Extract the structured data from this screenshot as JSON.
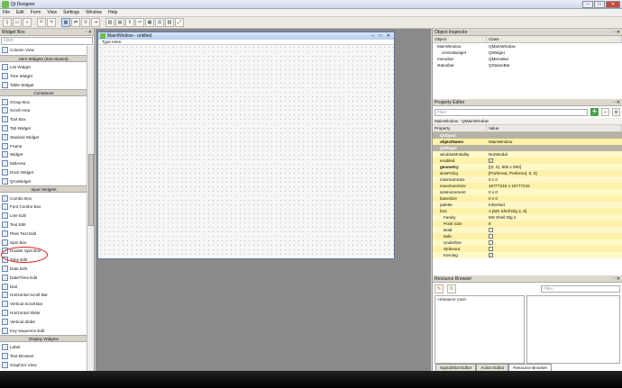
{
  "app": {
    "title": "Qt Designer"
  },
  "window_buttons": {
    "minimize": "–",
    "maximize": "□",
    "close": "✕"
  },
  "menu": [
    "File",
    "Edit",
    "Form",
    "View",
    "Settings",
    "Window",
    "Help"
  ],
  "toolbar_icons": [
    "new-icon",
    "open-icon",
    "save-icon",
    "sep",
    "undo-icon",
    "redo-icon",
    "sep",
    "edit-widgets-icon",
    "edit-signals-icon",
    "edit-buddies-icon",
    "edit-tab-order-icon",
    "sep",
    "layout-horizontal-icon",
    "layout-vertical-icon",
    "layout-split-horizontal-icon",
    "layout-split-vertical-icon",
    "layout-grid-icon",
    "layout-form-icon",
    "break-layout-icon",
    "adjust-size-icon"
  ],
  "widget_box": {
    "title": "Widget Box",
    "filter_placeholder": "Filter",
    "items": [
      {
        "type": "item",
        "label": "Column View"
      },
      {
        "type": "cat",
        "label": "Item Widgets (Item-Based)"
      },
      {
        "type": "item",
        "label": "List Widget"
      },
      {
        "type": "item",
        "label": "Tree Widget"
      },
      {
        "type": "item",
        "label": "Table Widget"
      },
      {
        "type": "cat",
        "label": "Containers"
      },
      {
        "type": "item",
        "label": "Group Box"
      },
      {
        "type": "item",
        "label": "Scroll Area"
      },
      {
        "type": "item",
        "label": "Tool Box"
      },
      {
        "type": "item",
        "label": "Tab Widget"
      },
      {
        "type": "item",
        "label": "Stacked Widget"
      },
      {
        "type": "item",
        "label": "Frame"
      },
      {
        "type": "item",
        "label": "Widget"
      },
      {
        "type": "item",
        "label": "MdiArea"
      },
      {
        "type": "item",
        "label": "Dock Widget"
      },
      {
        "type": "item",
        "label": "QAxWidget"
      },
      {
        "type": "cat",
        "label": "Input Widgets"
      },
      {
        "type": "item",
        "label": "Combo Box"
      },
      {
        "type": "item",
        "label": "Font Combo Box"
      },
      {
        "type": "item",
        "label": "Line Edit"
      },
      {
        "type": "item",
        "label": "Text Edit"
      },
      {
        "type": "item",
        "label": "Plain Text Edit"
      },
      {
        "type": "item",
        "label": "Spin Box"
      },
      {
        "type": "item",
        "label": "Double Spin Box"
      },
      {
        "type": "item",
        "label": "Time Edit"
      },
      {
        "type": "item",
        "label": "Date Edit"
      },
      {
        "type": "item",
        "label": "Date/Time Edit"
      },
      {
        "type": "item",
        "label": "Dial"
      },
      {
        "type": "item",
        "label": "Horizontal Scroll Bar"
      },
      {
        "type": "item",
        "label": "Vertical Scroll Bar"
      },
      {
        "type": "item",
        "label": "Horizontal Slider"
      },
      {
        "type": "item",
        "label": "Vertical Slider"
      },
      {
        "type": "item",
        "label": "Key sequence Edit"
      },
      {
        "type": "cat",
        "label": "Display Widgets"
      },
      {
        "type": "item",
        "label": "Label"
      },
      {
        "type": "item",
        "label": "Text Browser"
      },
      {
        "type": "item",
        "label": "Graphics View"
      }
    ]
  },
  "form_window": {
    "title": "MainWindow - untitled",
    "menu_placeholder": "Type Here"
  },
  "object_inspector": {
    "title": "Object Inspector",
    "columns": [
      "Object",
      "Class"
    ],
    "rows": [
      {
        "object": "MainWindow",
        "class": "QMainWindow",
        "indent": 1
      },
      {
        "object": "centralwidget",
        "class": "QWidget",
        "indent": 2
      },
      {
        "object": "menubar",
        "class": "QMenuBar",
        "indent": 1
      },
      {
        "object": "statusbar",
        "class": "QStatusBar",
        "indent": 1
      }
    ]
  },
  "property_editor": {
    "title": "Property Editor",
    "filter_placeholder": "Filter",
    "class_line": "MainWindow : QMainWindow",
    "columns": [
      "Property",
      "Value"
    ],
    "rows": [
      {
        "kind": "cat",
        "name": "QObject",
        "value": ""
      },
      {
        "kind": "prop",
        "name": "objectName",
        "value": "MainWindow",
        "bold": true
      },
      {
        "kind": "cat",
        "name": "QWidget",
        "value": ""
      },
      {
        "kind": "prop",
        "name": "windowModality",
        "value": "NonModal"
      },
      {
        "kind": "prop",
        "name": "enabled",
        "value": "✓",
        "check": true
      },
      {
        "kind": "prop",
        "name": "geometry",
        "value": "[(0, 0), 800 x 600]",
        "bold": true
      },
      {
        "kind": "prop",
        "name": "sizePolicy",
        "value": "[Preferred, Preferred, 0, 0]"
      },
      {
        "kind": "prop",
        "name": "minimumSize",
        "value": "0 x 0"
      },
      {
        "kind": "prop",
        "name": "maximumSize",
        "value": "16777215 x 16777215"
      },
      {
        "kind": "prop",
        "name": "sizeIncrement",
        "value": "0 x 0"
      },
      {
        "kind": "prop",
        "name": "baseSize",
        "value": "0 x 0"
      },
      {
        "kind": "prop",
        "name": "palette",
        "value": "Inherited"
      },
      {
        "kind": "prop",
        "name": "font",
        "value": "A  [MS Shell Dlg 2, 8]"
      },
      {
        "kind": "prop",
        "name": "Family",
        "value": "MS Shell Dlg 2",
        "sub": true
      },
      {
        "kind": "prop",
        "name": "Point Size",
        "value": "8",
        "sub": true
      },
      {
        "kind": "prop",
        "name": "Bold",
        "value": "",
        "check": true,
        "sub": true
      },
      {
        "kind": "prop",
        "name": "Italic",
        "value": "",
        "check": true,
        "sub": true
      },
      {
        "kind": "prop",
        "name": "Underline",
        "value": "",
        "check": true,
        "sub": true
      },
      {
        "kind": "prop",
        "name": "Strikeout",
        "value": "",
        "check": true,
        "sub": true
      },
      {
        "kind": "prop",
        "name": "Kerning",
        "value": "✓",
        "check": true,
        "sub": true
      }
    ]
  },
  "resource_browser": {
    "title": "Resource Browser",
    "filter_placeholder": "Filter",
    "root": "<resource root>",
    "tabs": [
      "Signal/Slot Editor",
      "Action Editor",
      "Resource Browser"
    ],
    "active_tab": 2
  }
}
